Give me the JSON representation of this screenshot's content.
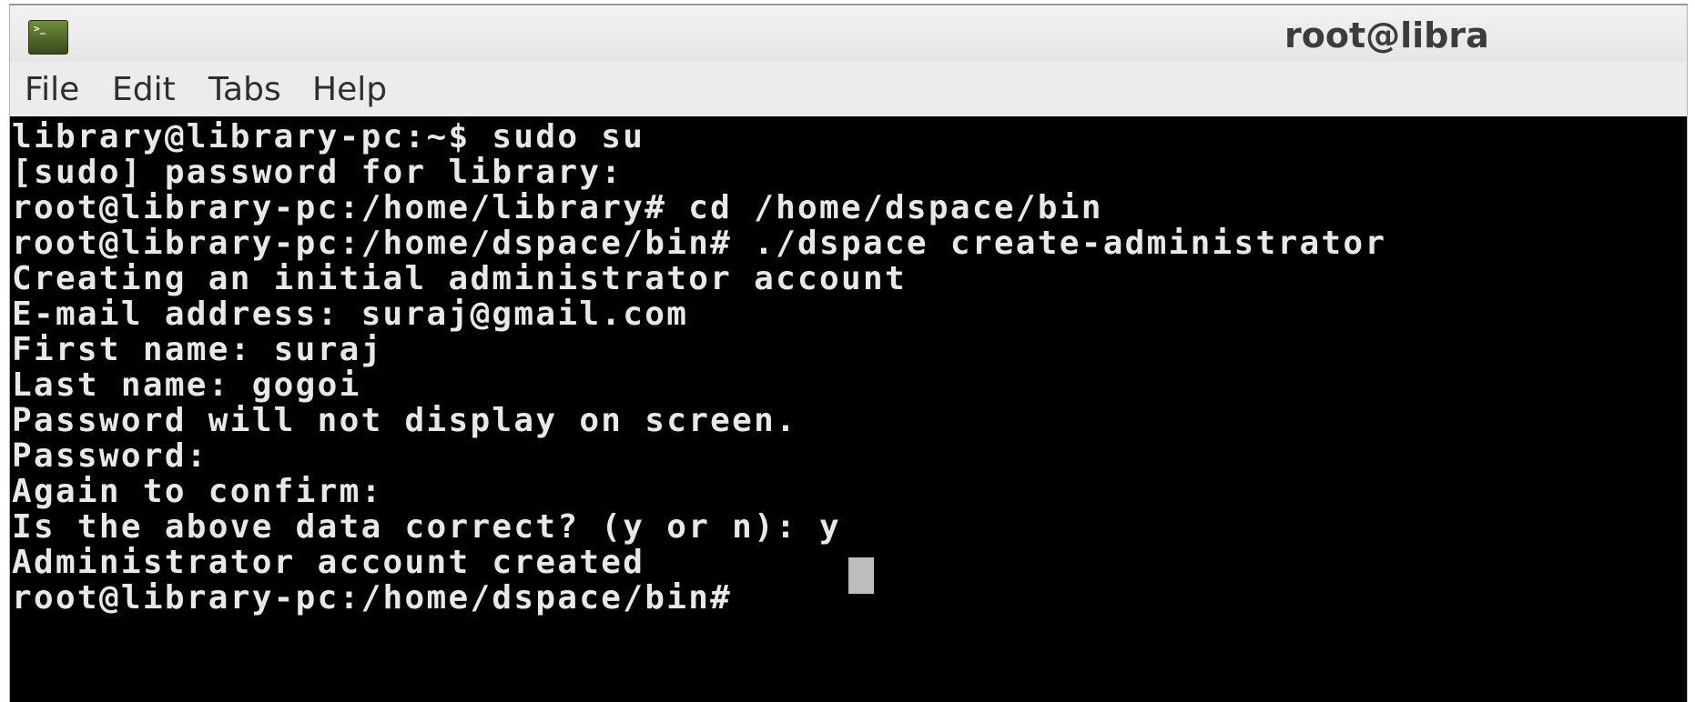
{
  "window": {
    "title": "root@libra"
  },
  "menu": {
    "items": [
      "File",
      "Edit",
      "Tabs",
      "Help"
    ]
  },
  "terminal": {
    "lines": [
      "library@library-pc:~$ sudo su",
      "[sudo] password for library:",
      "root@library-pc:/home/library# cd /home/dspace/bin",
      "root@library-pc:/home/dspace/bin# ./dspace create-administrator",
      "Creating an initial administrator account",
      "E-mail address: suraj@gmail.com",
      "First name: suraj",
      "Last name: gogoi",
      "Password will not display on screen.",
      "Password:",
      "Again to confirm:",
      "Is the above data correct? (y or n): y",
      "Administrator account created",
      "root@library-pc:/home/dspace/bin# "
    ]
  },
  "colors": {
    "terminal_background": "#000000",
    "terminal_text": "#e8e8e8",
    "chrome_background": "#ececec",
    "icon_green": "#39481c"
  },
  "icons": {
    "app": "terminal-icon",
    "cursor": "block-cursor"
  }
}
